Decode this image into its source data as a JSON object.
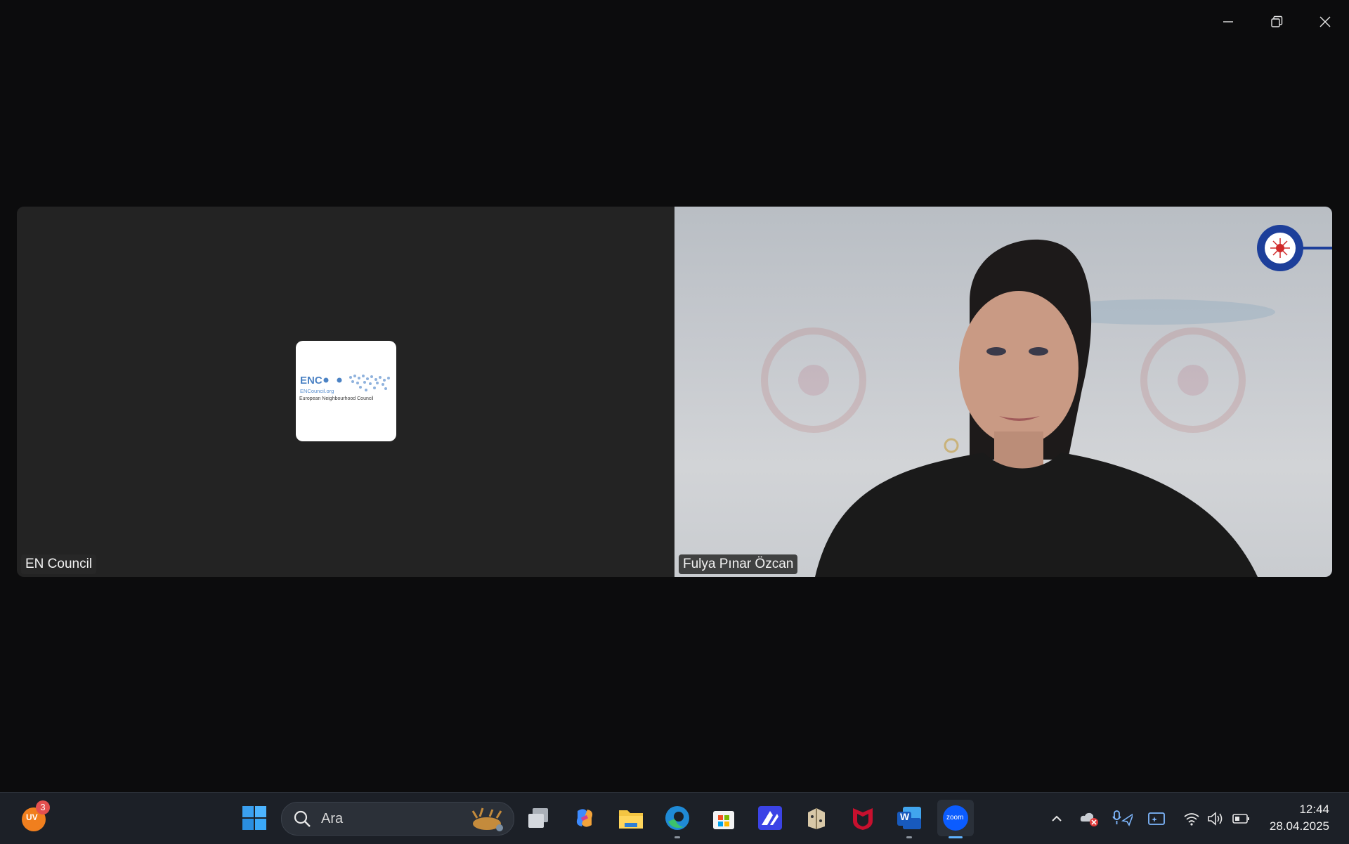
{
  "window": {
    "controls": [
      "minimize-icon",
      "restore-icon",
      "close-icon"
    ]
  },
  "participants": [
    {
      "name": "EN Council",
      "avatar": {
        "title": "ENC",
        "url": "ENCouncil.org",
        "subtitle": "European Neighbourhood Council"
      }
    },
    {
      "name": "Fulya Pınar Özcan"
    }
  ],
  "taskbar": {
    "weather": {
      "badge_text": "UV",
      "badge_count": "3"
    },
    "search": {
      "placeholder": "Ara"
    },
    "apps": [
      "start-icon",
      "task-view-icon",
      "copilot-icon",
      "file-explorer-icon",
      "edge-icon",
      "store-icon",
      "affinity-icon",
      "game-icon",
      "mcafee-icon",
      "word-icon",
      "zoom-icon"
    ],
    "zoom_label": "zoom",
    "word_label": "W",
    "clock": {
      "time": "12:44",
      "date": "28.04.2025"
    }
  },
  "colors": {
    "accent": "#5fb2ff",
    "zoom": "#0b5cff",
    "enc_blue": "#4b82c4"
  }
}
